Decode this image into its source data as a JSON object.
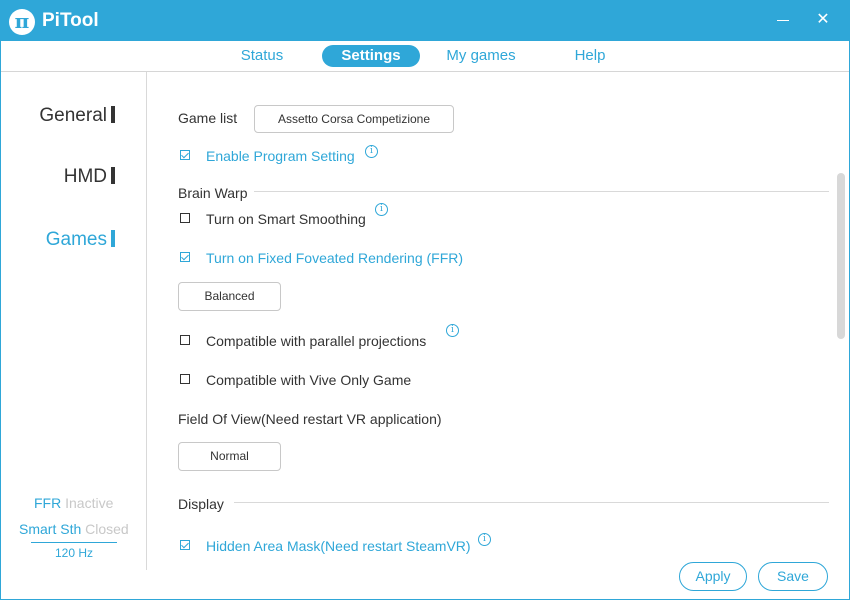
{
  "app": {
    "title": "PiTool",
    "logo_glyph": "π"
  },
  "window_controls": {
    "minimize": "minimize",
    "close": "✕"
  },
  "tabs": [
    {
      "label": "Status",
      "active": false
    },
    {
      "label": "Settings",
      "active": true
    },
    {
      "label": "My games",
      "active": false
    },
    {
      "label": "Help",
      "active": false
    }
  ],
  "sidebar": {
    "items": [
      {
        "label": "General",
        "active": false
      },
      {
        "label": "HMD",
        "active": false
      },
      {
        "label": "Games",
        "active": true
      }
    ],
    "status": {
      "ffr_label": "FFR",
      "ffr_value": "Inactive",
      "smooth_label": "Smart Sth",
      "smooth_value": "Closed",
      "refresh_rate": "120 Hz"
    }
  },
  "games": {
    "game_list_label": "Game list",
    "game_list_value": "Assetto Corsa Competizione",
    "enable_program_setting": {
      "label": "Enable Program Setting",
      "checked": true
    },
    "brain_warp_header": "Brain Warp",
    "smart_smoothing": {
      "label": "Turn on Smart Smoothing",
      "checked": false
    },
    "ffr": {
      "label": "Turn on Fixed Foveated Rendering (FFR)",
      "checked": true
    },
    "ffr_level": "Balanced",
    "parallel_projections": {
      "label": "Compatible with parallel projections",
      "checked": false
    },
    "vive_only": {
      "label": "Compatible with Vive Only Game",
      "checked": false
    },
    "fov_header": "Field Of View(Need restart VR application)",
    "fov_value": "Normal",
    "display_header": "Display",
    "hidden_area_mask": {
      "label": "Hidden Area Mask(Need restart SteamVR)",
      "checked": true
    }
  },
  "info_glyph": "i",
  "footer": {
    "apply": "Apply",
    "save": "Save"
  },
  "colors": {
    "accent": "#2fa7d8",
    "text": "#333333",
    "muted": "#c8c8c8"
  }
}
